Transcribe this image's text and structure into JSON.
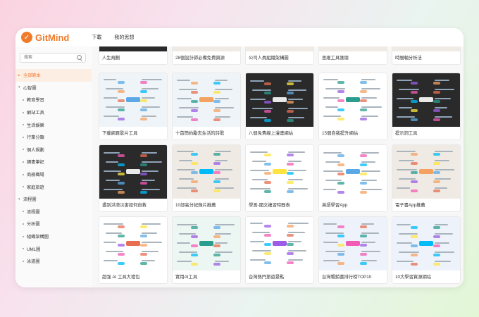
{
  "app": {
    "logo_text": "GitMind",
    "nav": [
      "下載",
      "我的思想"
    ],
    "brand_color": "#f07b2b"
  },
  "sidebar": {
    "search_placeholder": "搜索",
    "items": [
      {
        "label": "全部範本",
        "level": 0,
        "active": true
      },
      {
        "label": "心智圖",
        "level": 0,
        "expanded": true
      },
      {
        "label": "教育學習",
        "level": 1
      },
      {
        "label": "網站工具",
        "level": 1
      },
      {
        "label": "生活娛樂",
        "level": 1
      },
      {
        "label": "行業分類",
        "level": 1
      },
      {
        "label": "個人規劃",
        "level": 1
      },
      {
        "label": "讀書筆記",
        "level": 1
      },
      {
        "label": "商務職場",
        "level": 1
      },
      {
        "label": "家庭旅遊",
        "level": 1
      },
      {
        "label": "流程圖",
        "level": 0,
        "expanded": true
      },
      {
        "label": "流程圖",
        "level": 1
      },
      {
        "label": "分析圖",
        "level": 1
      },
      {
        "label": "組織架構圖",
        "level": 1
      },
      {
        "label": "UML圖",
        "level": 1
      },
      {
        "label": "泳道圖",
        "level": 1
      }
    ]
  },
  "templates": {
    "top_row": [
      "人生規劃",
      "28個設計師必備免費資源",
      "公司人員組織架構圖",
      "思維工具匯總",
      "時間軸分析法"
    ],
    "row1": [
      "下載網頁影片工具",
      "十首簡約勵志生活的詩歌",
      "八個免費線上漫畫網站",
      "15個自我提升網站",
      "提示詞工具"
    ],
    "row2": [
      "遇到洪澇災害如何自救",
      "10部高分紀錄片推薦",
      "學測-國文複習時間表",
      "英語學習App",
      "電子書App推薦"
    ],
    "row3": [
      "超強 AI 工具大禮包",
      "實用AI工具",
      "台灣熱門旅遊景點",
      "台灣暢銷書排行榜TOP10",
      "10大學習資源網站"
    ]
  }
}
